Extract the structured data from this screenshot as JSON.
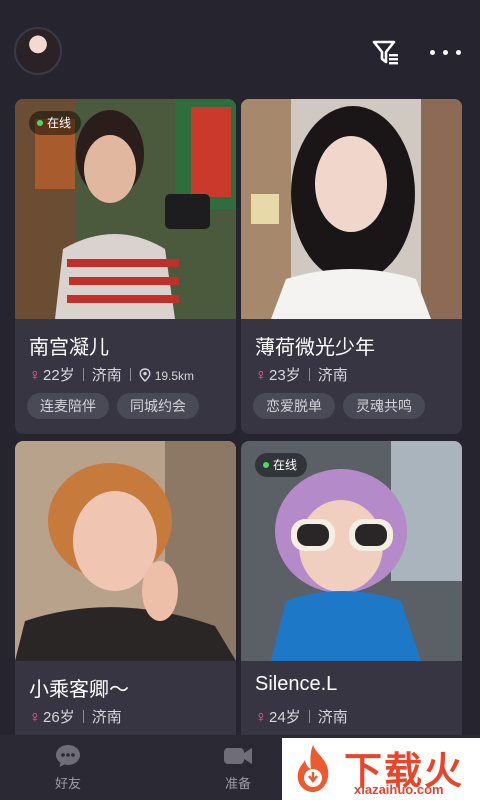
{
  "header": {
    "avatar_icon": "user-avatar",
    "filter_icon": "filter-icon",
    "more_icon": "more-icon"
  },
  "cards": [
    {
      "online": "在线",
      "name": "南宫凝儿",
      "age": "22岁",
      "city": "济南",
      "distance": "19.5km",
      "tags": [
        "连麦陪伴",
        "同城约会"
      ]
    },
    {
      "online": "",
      "name": "薄荷微光少年",
      "age": "23岁",
      "city": "济南",
      "distance": "",
      "tags": [
        "恋爱脱单",
        "灵魂共鸣"
      ]
    },
    {
      "online": "",
      "name": "小乘客卿～",
      "age": "26岁",
      "city": "济南",
      "distance": "",
      "tags": []
    },
    {
      "online": "在线",
      "name": "Silence.L",
      "age": "24岁",
      "city": "济南",
      "distance": "",
      "tags": []
    }
  ],
  "tabbar": {
    "friends": "好友",
    "ready": "准备"
  },
  "watermark": {
    "title": "下载火",
    "url": "xiazaihuo.com"
  },
  "colors": {
    "background": "#26252f",
    "card": "#363541",
    "female": "#ff5b9a",
    "online_dot": "#4cd964"
  }
}
